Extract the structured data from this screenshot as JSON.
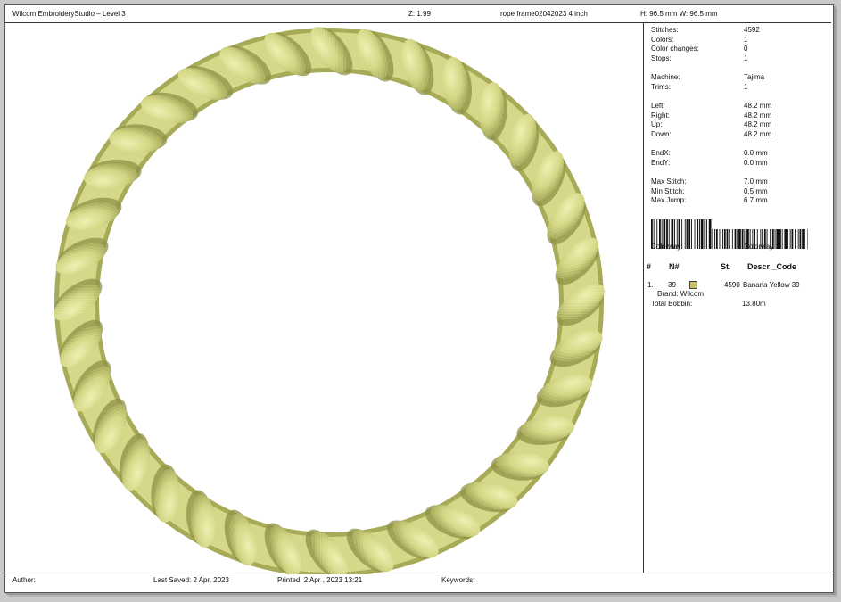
{
  "header": {
    "app_title": "Wilcom EmbroideryStudio – Level 3",
    "zoom": "Z: 1.99",
    "design_name": "rope frame02042023 4 inch",
    "dimensions": "H: 96.5 mm   W: 96.5 mm"
  },
  "stats": {
    "stitches_label": "Stitches:",
    "stitches": "4592",
    "colors_label": "Colors:",
    "colors": "1",
    "color_changes_label": "Color changes:",
    "color_changes": "0",
    "stops_label": "Stops:",
    "stops": "1",
    "machine_label": "Machine:",
    "machine": "Tajima",
    "trims_label": "Trims:",
    "trims": "1",
    "left_label": "Left:",
    "left": "48.2 mm",
    "right_label": "Right:",
    "right": "48.2 mm",
    "up_label": "Up:",
    "up": "48.2 mm",
    "down_label": "Down:",
    "down": "48.2 mm",
    "endx_label": "EndX:",
    "endx": "0.0 mm",
    "endy_label": "EndY:",
    "endy": "0.0 mm",
    "max_stitch_label": "Max Stitch:",
    "max_stitch": "7.0 mm",
    "min_stitch_label": "Min Stitch:",
    "min_stitch": "0.5 mm",
    "max_jump_label": "Max Jump:",
    "max_jump": "6.7 mm"
  },
  "colorway": {
    "label": "Colorway:",
    "value": "Colorway 1",
    "headers": {
      "num": "#",
      "n": "N#",
      "st": "St.",
      "descr": "Descr _Code"
    },
    "rows": [
      {
        "index": "1.",
        "n": "39",
        "swatch": "#c8be6e",
        "stitches": "4590",
        "descr": "Banana Yellow 39",
        "brand": "Brand: Wilcom"
      }
    ],
    "total_bobbin_label": "Total Bobbin:",
    "total_bobbin": "13.80m"
  },
  "footer": {
    "author": "Author:",
    "last_saved": "Last Saved:  2 Apr, 2023",
    "printed": "Printed:  2 Apr , 2023 13:21",
    "keywords": "Keywords:"
  },
  "colors": {
    "thread_light": "#e4e79c",
    "thread_mid": "#c9cc78",
    "thread_shadow": "#8e9145"
  }
}
